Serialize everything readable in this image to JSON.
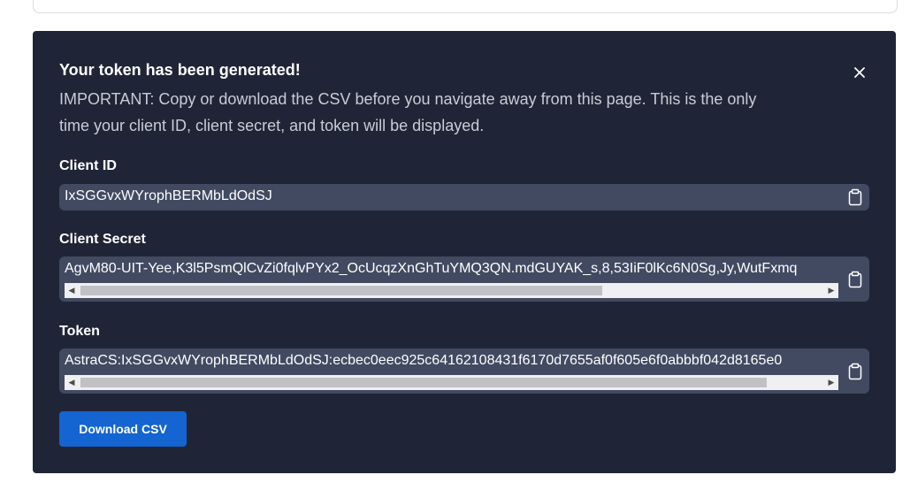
{
  "panel": {
    "title": "Your token has been generated!",
    "message": "IMPORTANT: Copy or download the CSV before you navigate away from this page. This is the only time your client ID, client secret, and token will be displayed.",
    "close_icon": "close-icon"
  },
  "fields": {
    "client_id": {
      "label": "Client ID",
      "value": "IxSGGvxWYrophBERMbLdOdSJ",
      "icon": "clipboard-icon"
    },
    "client_secret": {
      "label": "Client Secret",
      "value": "AgvM80-UIT-Yee,K3l5PsmQlCvZi0fqlvPYx2_OcUcqzXnGhTuYMQ3QN.mdGUYAK_s,8,53IiF0lKc6N0Sg,Jy,WutFxmq",
      "icon": "clipboard-icon",
      "scroll_fraction": 0.7
    },
    "token": {
      "label": "Token",
      "value": "AstraCS:IxSGGvxWYrophBERMbLdOdSJ:ecbec0eec925c64162108431f6170d7655af0f605e6f0abbbf042d8165e0",
      "icon": "clipboard-icon",
      "scroll_fraction": 0.92
    }
  },
  "actions": {
    "download_label": "Download CSV"
  },
  "colors": {
    "panel_bg": "#1f2536",
    "field_bg": "#414a61",
    "primary_button": "#1464d2",
    "muted_text": "#c9ccd4"
  }
}
